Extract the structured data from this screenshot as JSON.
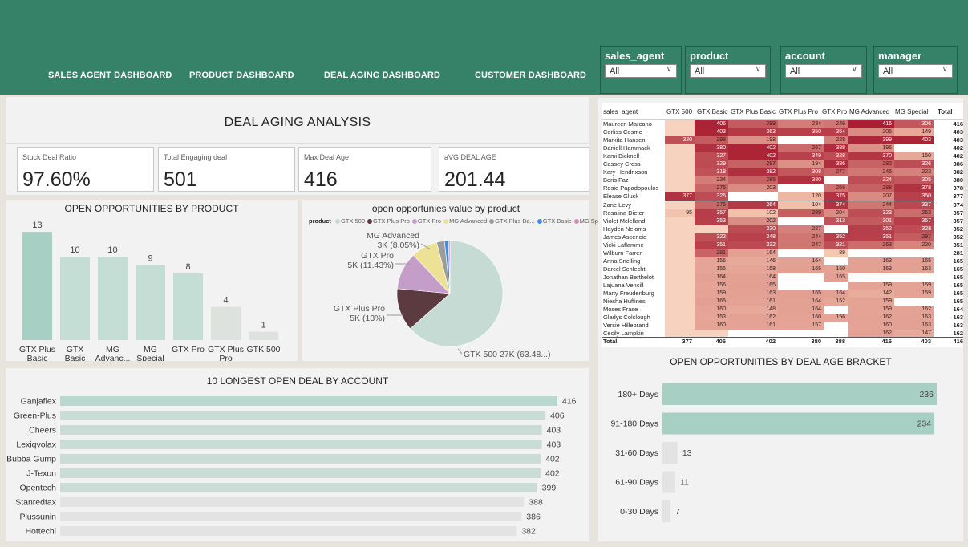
{
  "nav": [
    {
      "label": "SALES AGENT DASHBOARD"
    },
    {
      "label": "PRODUCT DASHBOARD"
    },
    {
      "label": "DEAL AGING DASHBOARD"
    },
    {
      "label": "CUSTOMER DASHBOARD"
    }
  ],
  "slicers": [
    {
      "title": "sales_agent",
      "value": "All"
    },
    {
      "title": "product",
      "value": "All"
    },
    {
      "title": "account",
      "value": "All"
    },
    {
      "title": "manager",
      "value": "All"
    }
  ],
  "page_title": "DEAL AGING ANALYSIS",
  "kpis": [
    {
      "label": "Stuck Deal Ratio",
      "value": "97.60%"
    },
    {
      "label": "Total Engaging deal",
      "value": "501"
    },
    {
      "label": "Max Deal Age",
      "value": "416"
    },
    {
      "label": "aVG DEAL AGE",
      "value": "201.44"
    }
  ],
  "colors": {
    "accent": "#358269",
    "bar_teal": "#a8cfc3",
    "bar_light": "#dde7e2",
    "bar_grey": "#e6e6e6"
  },
  "chart_data": [
    {
      "type": "bar",
      "title": "OPEN OPPORTUNITIES BY PRODUCT",
      "categories": [
        "GTX Plus Basic",
        "GTX Basic",
        "MG Advanc...",
        "MG Special",
        "GTX Pro",
        "GTX Plus Pro",
        "GTK 500"
      ],
      "values": [
        13,
        10,
        10,
        9,
        8,
        4,
        1
      ],
      "ylim": [
        0,
        14
      ]
    },
    {
      "type": "pie",
      "title": "open opportunies value by product",
      "legend_title": "product",
      "legend": [
        "GTX 500",
        "GTX Plus Pro",
        "GTX Pro",
        "MG Advanced",
        "GTX Plus Ba...",
        "GTX Basic",
        "MG Special"
      ],
      "slices": [
        {
          "name": "GTK 500",
          "value": 63.48,
          "color": "#c5dbd3",
          "label": "GTK 500 27K (63.48...)"
        },
        {
          "name": "GTX Plus Pro",
          "value": 13.0,
          "color": "#5b3b3f",
          "label_top": "GTX Plus Pro",
          "label_bottom": "5K (13%)"
        },
        {
          "name": "GTX Pro",
          "value": 11.43,
          "color": "#c49dc8",
          "label_top": "GTX Pro",
          "label_bottom": "5K (11.43%)"
        },
        {
          "name": "MG Advanced",
          "value": 8.05,
          "color": "#ede196",
          "label_top": "MG Advanced",
          "label_bottom": "3K (8.05%)"
        },
        {
          "name": "GTX Plus Basic",
          "value": 2.4,
          "color": "#9c9c9c"
        },
        {
          "name": "GTX Basic",
          "value": 1.2,
          "color": "#3d8fe0"
        },
        {
          "name": "MG Special",
          "value": 0.44,
          "color": "#d88ab7"
        }
      ],
      "legend_colors": [
        "#c5dbd3",
        "#5b3b3f",
        "#c49dc8",
        "#ede196",
        "#9c9c9c",
        "#3d8fe0",
        "#d88ab7"
      ]
    },
    {
      "type": "bar",
      "title": "10 LONGEST OPEN DEAL BY ACCOUNT",
      "categories": [
        "Ganjaflex",
        "Green-Plus",
        "Cheers",
        "Lexiqvolax",
        "Bubba Gump",
        "J-Texon",
        "Opentech",
        "Stanredtax",
        "Plussunin",
        "Hottechi"
      ],
      "values": [
        416,
        406,
        403,
        403,
        402,
        402,
        399,
        388,
        386,
        382
      ],
      "xlim": [
        0,
        416
      ]
    },
    {
      "type": "bar",
      "title": "OPEN OPPORTUNITIES BY DEAL AGE BRACKET",
      "categories": [
        "180+ Days",
        "91-180 Days",
        "31-60 Days",
        "61-90 Days",
        "0-30 Days"
      ],
      "values": [
        236,
        234,
        13,
        11,
        7
      ],
      "xlim": [
        0,
        236
      ]
    },
    {
      "type": "table",
      "columns": [
        "sales_agent",
        "GTX 500",
        "GTX Basic",
        "GTX Plus Basic",
        "GTX Plus Pro",
        "GTX Pro",
        "MG Advanced",
        "MG Special",
        "Total"
      ],
      "rows": [
        {
          "name": "Maureen Marcano",
          "values": [
            null,
            406,
            299,
            234,
            246,
            416,
            306
          ],
          "total": 416
        },
        {
          "name": "Corliss Cosme",
          "values": [
            null,
            403,
            363,
            350,
            354,
            205,
            149
          ],
          "total": 403
        },
        {
          "name": "Markita Hansen",
          "values": [
            320,
            298,
            198,
            null,
            228,
            399,
            403
          ],
          "total": 403
        },
        {
          "name": "Daniell Hammack",
          "values": [
            null,
            380,
            402,
            267,
            388,
            196,
            null
          ],
          "total": 402
        },
        {
          "name": "Kami Bicknell",
          "values": [
            null,
            327,
            402,
            349,
            328,
            370,
            150
          ],
          "total": 402
        },
        {
          "name": "Cassey Cress",
          "values": [
            null,
            329,
            287,
            194,
            386,
            282,
            326
          ],
          "total": 386
        },
        {
          "name": "Kary Hendrixson",
          "values": [
            null,
            318,
            382,
            308,
            277,
            246,
            223
          ],
          "total": 382
        },
        {
          "name": "Boris Faz",
          "values": [
            null,
            234,
            285,
            380,
            null,
            324,
            305
          ],
          "total": 380
        },
        {
          "name": "Rosie Papadopoulos",
          "values": [
            null,
            276,
            203,
            null,
            256,
            288,
            378
          ],
          "total": 378
        },
        {
          "name": "Elease Gluck",
          "values": [
            377,
            326,
            null,
            120,
            375,
            207,
            350
          ],
          "total": 377
        },
        {
          "name": "Zane Levy",
          "values": [
            null,
            276,
            364,
            104,
            374,
            244,
            337
          ],
          "total": 374
        },
        {
          "name": "Rosalina Dieter",
          "values": [
            95,
            357,
            102,
            289,
            204,
            323,
            263
          ],
          "total": 357
        },
        {
          "name": "Violet Mclelland",
          "values": [
            null,
            353,
            202,
            null,
            313,
            301,
            357
          ],
          "total": 357
        },
        {
          "name": "Hayden Neloms",
          "values": [
            null,
            null,
            330,
            227,
            null,
            352,
            328
          ],
          "total": 352
        },
        {
          "name": "James Ascencio",
          "values": [
            null,
            322,
            348,
            244,
            352,
            351,
            297
          ],
          "total": 352
        },
        {
          "name": "Vicki Laflamme",
          "values": [
            null,
            351,
            332,
            247,
            321,
            263,
            220
          ],
          "total": 351
        },
        {
          "name": "Wilburn Farren",
          "values": [
            null,
            281,
            164,
            null,
            88,
            null,
            null
          ],
          "total": 281
        },
        {
          "name": "Anna Snelling",
          "values": [
            null,
            156,
            146,
            164,
            null,
            163,
            165
          ],
          "total": 165
        },
        {
          "name": "Darcel Schlecht",
          "values": [
            null,
            155,
            158,
            165,
            160,
            163,
            163
          ],
          "total": 165
        },
        {
          "name": "Jonathan Berthelot",
          "values": [
            null,
            164,
            164,
            null,
            165,
            null,
            null
          ],
          "total": 165
        },
        {
          "name": "Lajuana Vencill",
          "values": [
            null,
            156,
            165,
            null,
            null,
            159,
            159
          ],
          "total": 165
        },
        {
          "name": "Marty Freudenburg",
          "values": [
            null,
            159,
            163,
            165,
            164,
            142,
            159
          ],
          "total": 165
        },
        {
          "name": "Niesha Huffines",
          "values": [
            null,
            165,
            161,
            164,
            152,
            159,
            null
          ],
          "total": 165
        },
        {
          "name": "Moses Frase",
          "values": [
            null,
            160,
            148,
            164,
            null,
            159,
            162
          ],
          "total": 164
        },
        {
          "name": "Gladys Colclough",
          "values": [
            null,
            153,
            162,
            160,
            156,
            162,
            163
          ],
          "total": 163
        },
        {
          "name": "Versie Hillebrand",
          "values": [
            null,
            160,
            161,
            157,
            null,
            160,
            163
          ],
          "total": 163
        },
        {
          "name": "Cecily Lampkin",
          "values": [
            null,
            null,
            null,
            null,
            null,
            162,
            147
          ],
          "total": 162
        }
      ],
      "total_row": {
        "name": "Total",
        "values": [
          377,
          406,
          402,
          380,
          388,
          416,
          403
        ],
        "total": 416
      }
    }
  ]
}
